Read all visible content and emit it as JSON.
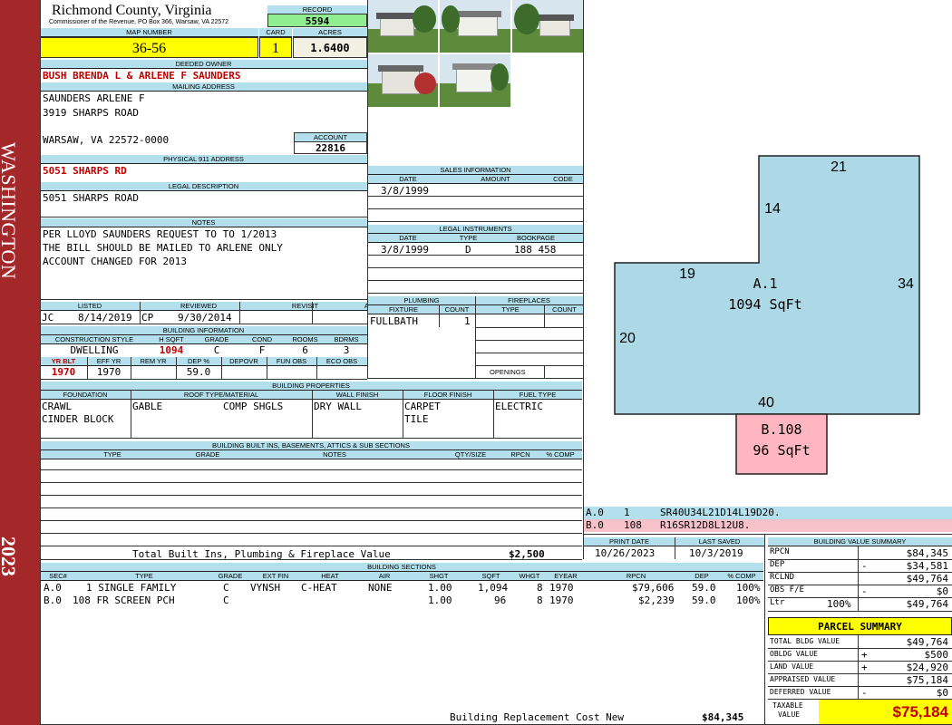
{
  "district": "WASHINGTON",
  "year": "2023",
  "county": {
    "name": "Richmond County, Virginia",
    "address": "Commissioner of the Revenue, PO Box 366, Warsaw, VA 22572"
  },
  "record": {
    "label": "RECORD",
    "value": "5594"
  },
  "map_number": {
    "label": "MAP NUMBER",
    "value": "36-56"
  },
  "card": {
    "label": "CARD",
    "value": "1"
  },
  "acres": {
    "label": "ACRES",
    "value": "1.6400"
  },
  "deeded_owner": {
    "label": "DEEDED OWNER",
    "value": "BUSH BRENDA L & ARLENE F SAUNDERS"
  },
  "mailing_address": {
    "label": "MAILING ADDRESS",
    "line1": "SAUNDERS ARLENE F",
    "line2": "3919 SHARPS ROAD",
    "line3": "WARSAW, VA 22572-0000"
  },
  "account": {
    "label": "ACCOUNT",
    "value": "22816"
  },
  "physical_address": {
    "label": "PHYSICAL 911 ADDRESS",
    "value": "5051 SHARPS RD"
  },
  "legal_description": {
    "label": "LEGAL DESCRIPTION",
    "value": "5051 SHARPS ROAD"
  },
  "notes": {
    "label": "NOTES",
    "lines": [
      "PER LLOYD SAUNDERS REQUEST TO TO 1/2013",
      "THE BILL SHOULD BE MAILED TO ARLENE ONLY",
      "ACCOUNT CHANGED FOR 2013"
    ]
  },
  "listed": {
    "label": "LISTED",
    "by": "JC",
    "date": "8/14/2019"
  },
  "reviewed": {
    "label": "REVIEWED",
    "by": "CP",
    "date": "9/30/2014"
  },
  "revisit": {
    "label": "REVISIT",
    "value": ""
  },
  "appeals": {
    "label": "APPEALS",
    "value": ""
  },
  "building_info": {
    "label": "BUILDING INFORMATION",
    "headers": [
      "CONSTRUCTION STYLE",
      "H SQFT",
      "GRADE",
      "COND",
      "ROOMS",
      "BDRMS"
    ],
    "values": [
      "DWELLING",
      "1094",
      "C",
      "F",
      "6",
      "3"
    ],
    "headers2": [
      "YR BLT",
      "EFF YR",
      "REM YR",
      "DEP %",
      "DEPOVR",
      "FUN OBS",
      "ECO OBS"
    ],
    "values2": [
      "1970",
      "1970",
      "",
      "59.0",
      "",
      "",
      ""
    ]
  },
  "sales": {
    "label": "SALES INFORMATION",
    "headers": [
      "DATE",
      "AMOUNT",
      "CODE"
    ],
    "rows": [
      [
        "3/8/1999",
        "",
        ""
      ]
    ]
  },
  "legal_instruments": {
    "label": "LEGAL INSTRUMENTS",
    "headers": [
      "DATE",
      "TYPE",
      "BOOKPAGE"
    ],
    "rows": [
      [
        "3/8/1999",
        "D",
        "188 458"
      ]
    ]
  },
  "plumbing": {
    "label": "PLUMBING",
    "headers": [
      "FIXTURE",
      "COUNT"
    ],
    "rows": [
      [
        "FULLBATH",
        "1"
      ]
    ]
  },
  "fireplaces": {
    "label": "FIREPLACES",
    "headers": [
      "TYPE",
      "COUNT"
    ],
    "openings_label": "OPENINGS"
  },
  "building_properties": {
    "label": "BUILDING PROPERTIES",
    "headers": [
      "FOUNDATION",
      "ROOF TYPE/MATERIAL",
      "WALL FINISH",
      "FLOOR FINISH",
      "FUEL TYPE"
    ],
    "foundation": [
      "CRAWL",
      "CINDER BLOCK"
    ],
    "roof_type": "GABLE",
    "roof_material": "COMP SHGLS",
    "wall_finish": "DRY WALL",
    "floor_finish": [
      "CARPET",
      "TILE"
    ],
    "fuel_type": "ELECTRIC"
  },
  "built_ins": {
    "label": "BUILDING BUILT INS, BASEMENTS, ATTICS & SUB SECTIONS",
    "headers": [
      "TYPE",
      "GRADE",
      "NOTES",
      "QTY/SIZE",
      "RPCN",
      "% COMP"
    ],
    "total_label": "Total Built Ins, Plumbing & Fireplace Value",
    "total_value": "$2,500"
  },
  "print_date": {
    "label": "PRINT DATE",
    "value": "10/26/2023"
  },
  "last_saved": {
    "label": "LAST SAVED",
    "value": "10/3/2019"
  },
  "building_sections": {
    "label": "BUILDING SECTIONS",
    "headers": [
      "SEC#",
      "TYPE",
      "GRADE",
      "EXT FIN",
      "HEAT",
      "AIR",
      "SHGT",
      "SQFT",
      "WHGT",
      "EYEAR",
      "RPCN",
      "DEP",
      "% COMP"
    ],
    "rows": [
      [
        "A.0",
        "1 SINGLE FAMILY",
        "C",
        "VYNSH",
        "C-HEAT",
        "NONE",
        "1.00",
        "1,094",
        "8",
        "1970",
        "$79,606",
        "59.0",
        "100%"
      ],
      [
        "B.0",
        "108 FR SCREEN PCH",
        "C",
        "",
        "",
        "",
        "1.00",
        "96",
        "8",
        "1970",
        "$2,239",
        "59.0",
        "100%"
      ]
    ],
    "replacement_label": "Building Replacement Cost New",
    "replacement_value": "$84,345"
  },
  "sketch": {
    "dims": {
      "top": "21",
      "notch_side": "14",
      "notch_top": "19",
      "right": "34",
      "left": "20",
      "bottom": "40"
    },
    "area_a_label": "A.1",
    "area_a_sqft": "1094 SqFt",
    "area_b_label": "B.108",
    "area_b_sqft": "96 SqFt",
    "legend": [
      {
        "code": "A.0",
        "num": "1",
        "path": "SR40U34L21D14L19D20.",
        "color": "#b3e0ec"
      },
      {
        "code": "B.0",
        "num": "108",
        "path": "R16SR12D8L12U8.",
        "color": "#f7c1c9"
      }
    ]
  },
  "building_value_summary": {
    "label": "BUILDING VALUE SUMMARY",
    "rows": [
      {
        "name": "RPCN",
        "sign": "",
        "pct": "",
        "value": "$84,345"
      },
      {
        "name": "DEP",
        "sign": "-",
        "pct": "",
        "value": "$34,581"
      },
      {
        "name": "RCLND",
        "sign": "",
        "pct": "",
        "value": "$49,764"
      },
      {
        "name": "OBS F/E",
        "sign": "-",
        "pct": "",
        "value": "$0"
      },
      {
        "name": "Ltr",
        "sign": "",
        "pct": "100%",
        "value": "$49,764"
      }
    ]
  },
  "parcel_summary": {
    "label": "PARCEL SUMMARY",
    "rows": [
      {
        "name": "TOTAL BLDG VALUE",
        "sign": "",
        "value": "$49,764"
      },
      {
        "name": "OBLDG VALUE",
        "sign": "+",
        "value": "$500"
      },
      {
        "name": "LAND VALUE",
        "sign": "+",
        "value": "$24,920"
      },
      {
        "name": "APPRAISED VALUE",
        "sign": "",
        "value": "$75,184"
      },
      {
        "name": "DEFERRED VALUE",
        "sign": "-",
        "value": "$0"
      }
    ],
    "taxable_label_1": "TAXABLE",
    "taxable_label_2": "VALUE",
    "taxable_value": "$75,184"
  },
  "colors": {
    "sidebar": "#a4282a",
    "label_bg": "#b3e0ec",
    "highlight": "#ffff00",
    "record_green": "#90ee90",
    "area_a": "#add8e6",
    "area_b": "#ffb6c1"
  }
}
